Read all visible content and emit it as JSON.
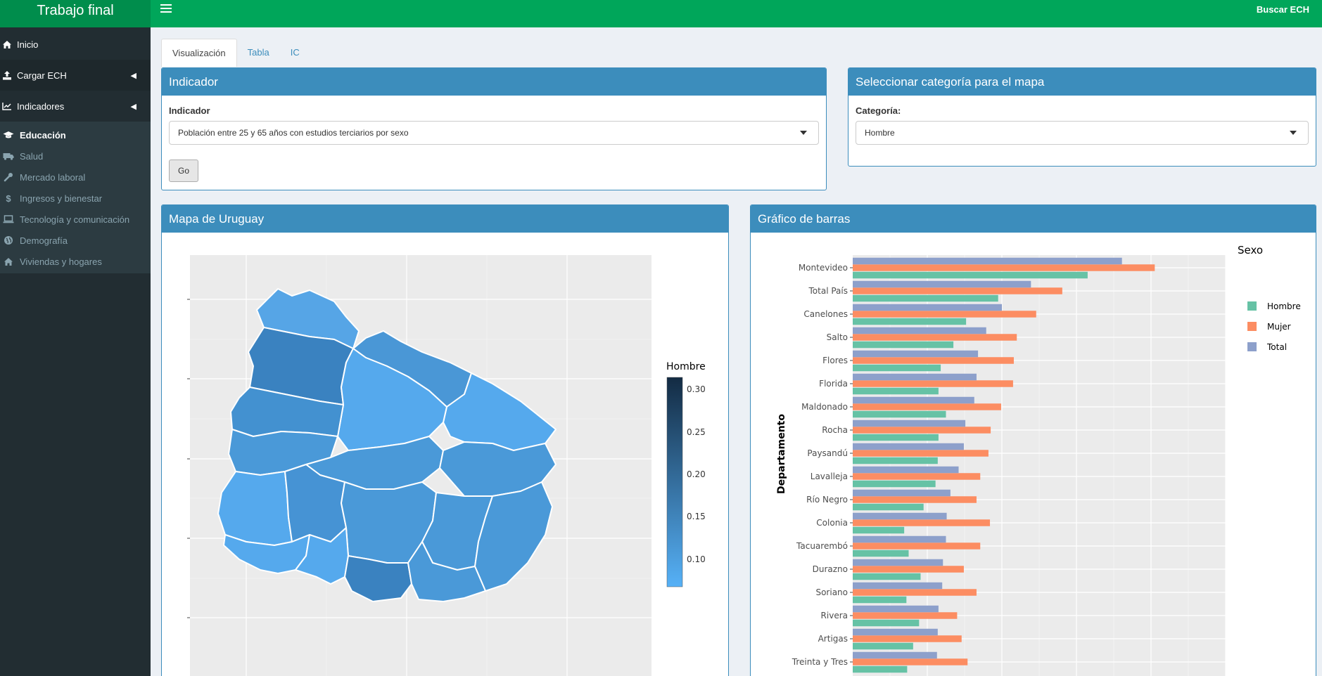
{
  "app": {
    "title": "Trabajo final",
    "top_right": "Buscar ECH"
  },
  "sidebar": {
    "items": [
      {
        "label": "Inicio",
        "icon": "home-icon"
      },
      {
        "label": "Cargar ECH",
        "icon": "upload-icon"
      },
      {
        "label": "Indicadores",
        "icon": "line-chart-icon"
      }
    ],
    "subitems": [
      {
        "label": "Educación",
        "icon": "graduation-cap-icon"
      },
      {
        "label": "Salud",
        "icon": "ambulance-icon"
      },
      {
        "label": "Mercado laboral",
        "icon": "wrench-icon"
      },
      {
        "label": "Ingresos y bienestar",
        "icon": "dollar-icon"
      },
      {
        "label": "Tecnología y comunicación",
        "icon": "laptop-icon"
      },
      {
        "label": "Demografía",
        "icon": "globe-icon"
      },
      {
        "label": "Viviendas y hogares",
        "icon": "home-icon"
      }
    ]
  },
  "tabs": [
    "Visualización",
    "Tabla",
    "IC"
  ],
  "indicator_box": {
    "title": "Indicador",
    "label": "Indicador",
    "selected": "Población entre 25 y 65 años con estudios terciarios por sexo",
    "go_label": "Go"
  },
  "category_box": {
    "title": "Seleccionar categoría para el mapa",
    "label": "Categoría:",
    "selected": "Hombre"
  },
  "map_box": {
    "title": "Mapa de Uruguay",
    "legend_title": "Hombre",
    "legend_ticks": [
      "0.30",
      "0.25",
      "0.20",
      "0.15",
      "0.10"
    ]
  },
  "bar_box": {
    "title": "Gráfico de barras"
  },
  "colors": {
    "header": "#00a65a",
    "logo": "#008d4c",
    "box": "#3c8dbc",
    "hombre": "#66c2a5",
    "mujer": "#fc8d62",
    "total": "#8da0cb"
  },
  "chart_data": {
    "type": "bar",
    "orientation": "horizontal",
    "ylabel": "Departamento",
    "legend_title": "Sexo",
    "legend_position": "right",
    "grid": true,
    "categories": [
      "Montevideo",
      "Total País",
      "Canelones",
      "Salto",
      "Flores",
      "Florida",
      "Maldonado",
      "Rocha",
      "Paysandú",
      "Lavalleja",
      "Río Negro",
      "Colonia",
      "Tacuarembó",
      "Durazno",
      "Soriano",
      "Rivera",
      "Artigas",
      "Treinta y Tres"
    ],
    "series": [
      {
        "name": "Hombre",
        "values": [
          0.315,
          0.195,
          0.152,
          0.135,
          0.118,
          0.115,
          0.125,
          0.115,
          0.114,
          0.111,
          0.095,
          0.069,
          0.075,
          0.091,
          0.072,
          0.089,
          0.081,
          0.073
        ]
      },
      {
        "name": "Mujer",
        "values": [
          0.405,
          0.281,
          0.246,
          0.22,
          0.216,
          0.215,
          0.199,
          0.185,
          0.182,
          0.171,
          0.166,
          0.184,
          0.171,
          0.149,
          0.166,
          0.14,
          0.146,
          0.154
        ]
      },
      {
        "name": "Total",
        "values": [
          0.361,
          0.239,
          0.2,
          0.179,
          0.168,
          0.166,
          0.163,
          0.151,
          0.149,
          0.142,
          0.131,
          0.126,
          0.125,
          0.121,
          0.12,
          0.115,
          0.114,
          0.113
        ]
      }
    ]
  }
}
